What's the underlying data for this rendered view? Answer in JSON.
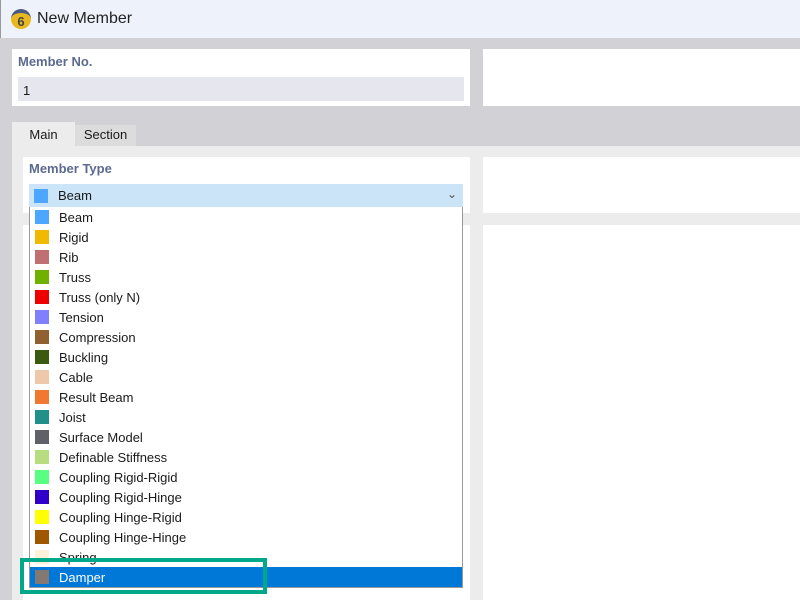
{
  "window": {
    "title": "New Member",
    "icon": "rfem-6-app-icon",
    "icon_text": "6"
  },
  "member_no": {
    "label": "Member No.",
    "value": "1"
  },
  "tabs": [
    {
      "label": "Main",
      "active": true
    },
    {
      "label": "Section",
      "active": false
    }
  ],
  "member_type": {
    "label": "Member Type",
    "selected": {
      "label": "Beam",
      "color": "#4da6ff"
    }
  },
  "dropdown": {
    "items": [
      {
        "label": "Beam",
        "color": "#4da6ff"
      },
      {
        "label": "Rigid",
        "color": "#f0b800"
      },
      {
        "label": "Rib",
        "color": "#c07070"
      },
      {
        "label": "Truss",
        "color": "#70b000"
      },
      {
        "label": "Truss (only N)",
        "color": "#ee0000"
      },
      {
        "label": "Tension",
        "color": "#8080ff"
      },
      {
        "label": "Compression",
        "color": "#906030"
      },
      {
        "label": "Buckling",
        "color": "#3a5a10"
      },
      {
        "label": "Cable",
        "color": "#eec8a8"
      },
      {
        "label": "Result Beam",
        "color": "#f07830"
      },
      {
        "label": "Joist",
        "color": "#209088"
      },
      {
        "label": "Surface Model",
        "color": "#606068"
      },
      {
        "label": "Definable Stiffness",
        "color": "#b8dc80"
      },
      {
        "label": "Coupling Rigid-Rigid",
        "color": "#58ff80"
      },
      {
        "label": "Coupling Rigid-Hinge",
        "color": "#3000c8"
      },
      {
        "label": "Coupling Hinge-Rigid",
        "color": "#ffff00"
      },
      {
        "label": "Coupling Hinge-Hinge",
        "color": "#a05800"
      },
      {
        "label": "Spring",
        "color": "#fff0d8"
      },
      {
        "label": "Damper",
        "color": "#857870",
        "selected": true
      }
    ]
  },
  "highlight_color": "#00a88a"
}
